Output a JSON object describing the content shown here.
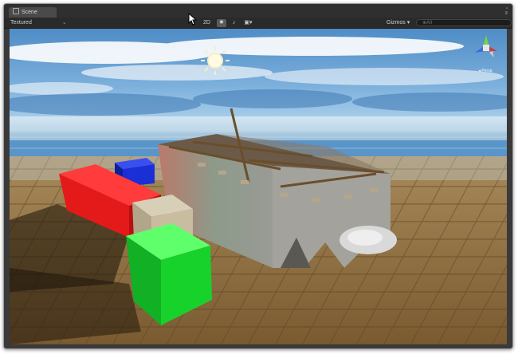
{
  "window": {
    "tab_title": "Scene",
    "tab_icon": "scene-icon",
    "controls": [
      "▫",
      "≡"
    ]
  },
  "toolbar": {
    "shading_mode": "Textured",
    "shading_chevron": "⌄",
    "mode_2d": "2D",
    "lighting_icon": "✸",
    "audio_icon": "♪",
    "effects_icon": "▣",
    "effects_chevron": "▾",
    "gizmos_label": "Gizmos",
    "gizmos_chevron": "▾",
    "search_placeholder": "⊕All"
  },
  "scene": {
    "gizmo_axes": [
      "x",
      "y",
      "z"
    ],
    "colors": {
      "sky": "#5a95c9",
      "red_cube": "#e41a1a",
      "blue_cube": "#1a2fd6",
      "green_cube": "#18d22c",
      "floor": "#8a6a3c"
    }
  }
}
